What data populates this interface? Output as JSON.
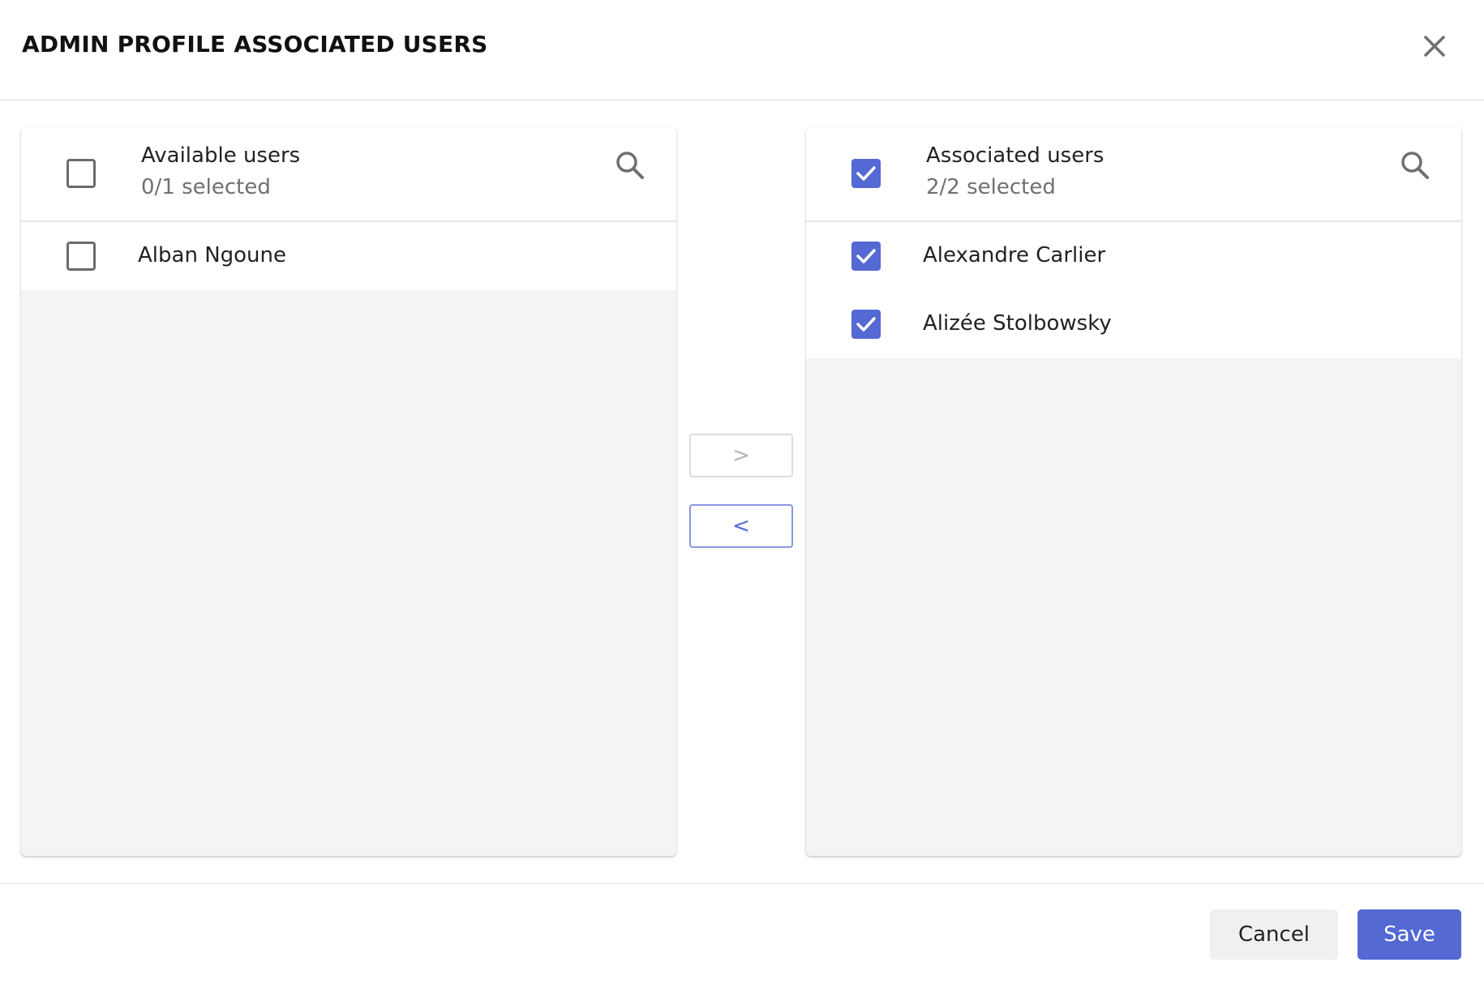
{
  "dialog": {
    "title": "ADMIN PROFILE ASSOCIATED USERS",
    "close_icon": "close-icon"
  },
  "available": {
    "title": "Available users",
    "selected_text": "0/1 selected",
    "select_all_checked": false,
    "search_icon": "search-icon",
    "users": [
      {
        "name": "Alban Ngoune",
        "checked": false
      }
    ]
  },
  "associated": {
    "title": "Associated users",
    "selected_text": "2/2 selected",
    "select_all_checked": true,
    "search_icon": "search-icon",
    "users": [
      {
        "name": "Alexandre Carlier",
        "checked": true
      },
      {
        "name": "Alizée Stolbowsky",
        "checked": true
      }
    ]
  },
  "transfer": {
    "move_right_label": ">",
    "move_left_label": "<",
    "move_right_enabled": false,
    "move_left_enabled": true
  },
  "footer": {
    "cancel_label": "Cancel",
    "save_label": "Save"
  },
  "colors": {
    "accent": "#5469d4",
    "panel_background": "#f4f4f4",
    "cancel_background": "#f0f0f2"
  }
}
